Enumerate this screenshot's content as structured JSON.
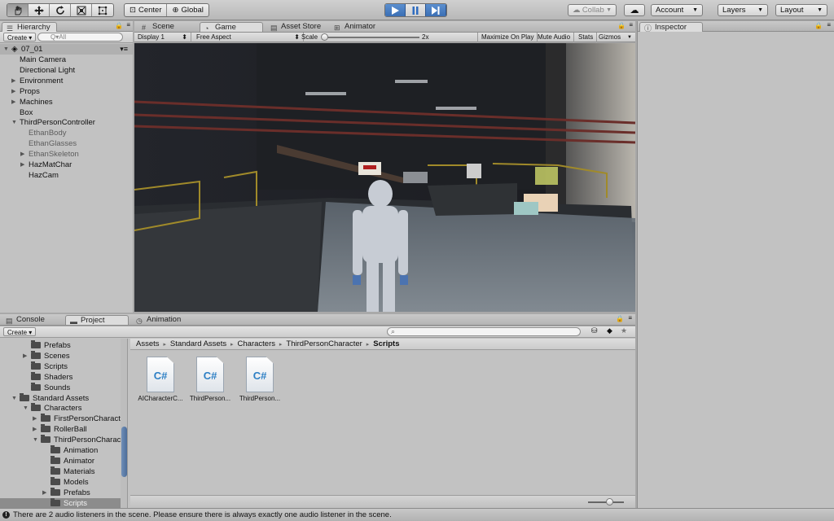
{
  "toolbar": {
    "tools": [
      "hand-tool",
      "move-tool",
      "rotate-tool",
      "scale-tool",
      "rect-tool"
    ],
    "pivot": "Center",
    "space": "Global",
    "collab": "Collab",
    "account": "Account",
    "layers": "Layers",
    "layout": "Layout"
  },
  "hierarchy": {
    "tab": "Hierarchy",
    "create": "Create",
    "search_placeholder": "Q▾All",
    "scene": "07_01",
    "items": [
      {
        "label": "Main Camera",
        "level": 1,
        "fold": false,
        "dim": false
      },
      {
        "label": "Directional Light",
        "level": 1,
        "fold": false,
        "dim": false
      },
      {
        "label": "Environment",
        "level": 1,
        "fold": true,
        "dim": false
      },
      {
        "label": "Props",
        "level": 1,
        "fold": true,
        "dim": false
      },
      {
        "label": "Machines",
        "level": 1,
        "fold": true,
        "dim": false
      },
      {
        "label": "Box",
        "level": 1,
        "fold": false,
        "dim": false
      },
      {
        "label": "ThirdPersonController",
        "level": 1,
        "fold": "open",
        "dim": false
      },
      {
        "label": "EthanBody",
        "level": 2,
        "fold": false,
        "dim": true
      },
      {
        "label": "EthanGlasses",
        "level": 2,
        "fold": false,
        "dim": true
      },
      {
        "label": "EthanSkeleton",
        "level": 2,
        "fold": true,
        "dim": true
      },
      {
        "label": "HazMatChar",
        "level": 2,
        "fold": true,
        "dim": false
      },
      {
        "label": "HazCam",
        "level": 2,
        "fold": false,
        "dim": false
      }
    ]
  },
  "center_tabs": {
    "scene": "Scene",
    "game": "Game",
    "asset_store": "Asset Store",
    "animator": "Animator"
  },
  "game_toolbar": {
    "display": "Display 1",
    "aspect": "Free Aspect",
    "scale_label": "Scale",
    "scale_value": "2x",
    "maximize": "Maximize On Play",
    "mute": "Mute Audio",
    "stats": "Stats",
    "gizmos": "Gizmos"
  },
  "inspector": {
    "tab": "Inspector"
  },
  "bottom_tabs": {
    "console": "Console",
    "project": "Project",
    "animation": "Animation"
  },
  "project": {
    "create": "Create",
    "tree": [
      {
        "label": "Prefabs",
        "level": 1,
        "fold": false
      },
      {
        "label": "Scenes",
        "level": 1,
        "fold": true
      },
      {
        "label": "Scripts",
        "level": 1,
        "fold": false
      },
      {
        "label": "Shaders",
        "level": 1,
        "fold": false
      },
      {
        "label": "Sounds",
        "level": 1,
        "fold": false
      },
      {
        "label": "Standard Assets",
        "level": 0,
        "fold": "open"
      },
      {
        "label": "Characters",
        "level": 1,
        "fold": "open"
      },
      {
        "label": "FirstPersonCharacte",
        "level": 2,
        "fold": true
      },
      {
        "label": "RollerBall",
        "level": 2,
        "fold": true
      },
      {
        "label": "ThirdPersonCharact",
        "level": 2,
        "fold": "open"
      },
      {
        "label": "Animation",
        "level": 3,
        "fold": false
      },
      {
        "label": "Animator",
        "level": 3,
        "fold": false
      },
      {
        "label": "Materials",
        "level": 3,
        "fold": false
      },
      {
        "label": "Models",
        "level": 3,
        "fold": false
      },
      {
        "label": "Prefabs",
        "level": 3,
        "fold": true
      },
      {
        "label": "Scripts",
        "level": 3,
        "fold": false,
        "selected": true
      }
    ],
    "breadcrumb": [
      "Assets",
      "Standard Assets",
      "Characters",
      "ThirdPersonCharacter",
      "Scripts"
    ],
    "assets": [
      "AICharacterC...",
      "ThirdPerson...",
      "ThirdPerson..."
    ],
    "asset_glyph": "C#"
  },
  "status": {
    "message": "There are 2 audio listeners in the scene. Please ensure there is always exactly one audio listener in the scene."
  },
  "colors": {
    "play_blue": "#3b6fb4",
    "panel_gray": "#c2c2c2",
    "selection_gray": "#8c8c8c"
  }
}
